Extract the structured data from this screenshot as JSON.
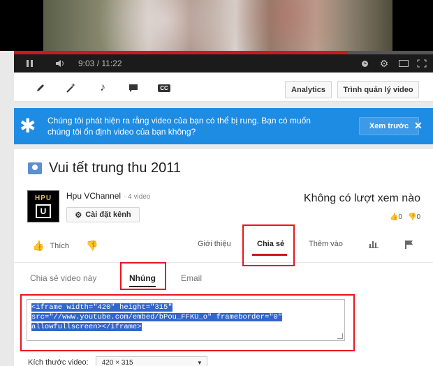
{
  "player": {
    "time_current": "9:03",
    "time_sep": " / ",
    "time_total": "11:22",
    "progress": 0.796,
    "icons": [
      "pause-icon",
      "volume-icon",
      "clock-icon",
      "gear-icon",
      "theater-icon",
      "fullscreen-icon"
    ]
  },
  "toolbar": {
    "analytics_label": "Analytics",
    "manager_label": "Trình quản lý video",
    "icons": [
      "pencil-icon",
      "magic-wand-icon",
      "music-note-icon",
      "comment-icon",
      "cc-icon"
    ]
  },
  "notice": {
    "message": "Chúng tôi phát hiện ra rằng video của bạn có thể bị rung. Bạn có muốn chúng tôi ổn định video của bạn không?",
    "preview_label": "Xem trước",
    "close_label": "✕"
  },
  "video": {
    "title": "Vui tết trung thu 2011",
    "channel_name": "Hpu VChannel",
    "video_count": "· 4 video",
    "settings_label": "Cài đặt kênh",
    "views": "Không có lượt xem nào",
    "likes": "0",
    "dislikes": "0",
    "avatar_text_top": "HPU",
    "avatar_text_bottom": "U"
  },
  "actions": {
    "like_label": "Thích",
    "about_label": "Giới thiệu",
    "share_label": "Chia sẻ",
    "add_label": "Thêm vào"
  },
  "share": {
    "tab_share": "Chia sẻ video này",
    "tab_embed": "Nhúng",
    "tab_email": "Email",
    "embed_line1": "<iframe width=\"420\" height=\"315\"",
    "embed_line2": "src=\"//www.youtube.com/embed/bPou_FFKU_o\" frameborder=\"0\"",
    "embed_line3": "allowfullscreen></iframe>",
    "size_label": "Kích thước video:",
    "size_value": "420 × 315"
  },
  "colors": {
    "accent": "#cc181e",
    "notice_bg": "#1e8ce3",
    "highlight": "#e8141e"
  }
}
